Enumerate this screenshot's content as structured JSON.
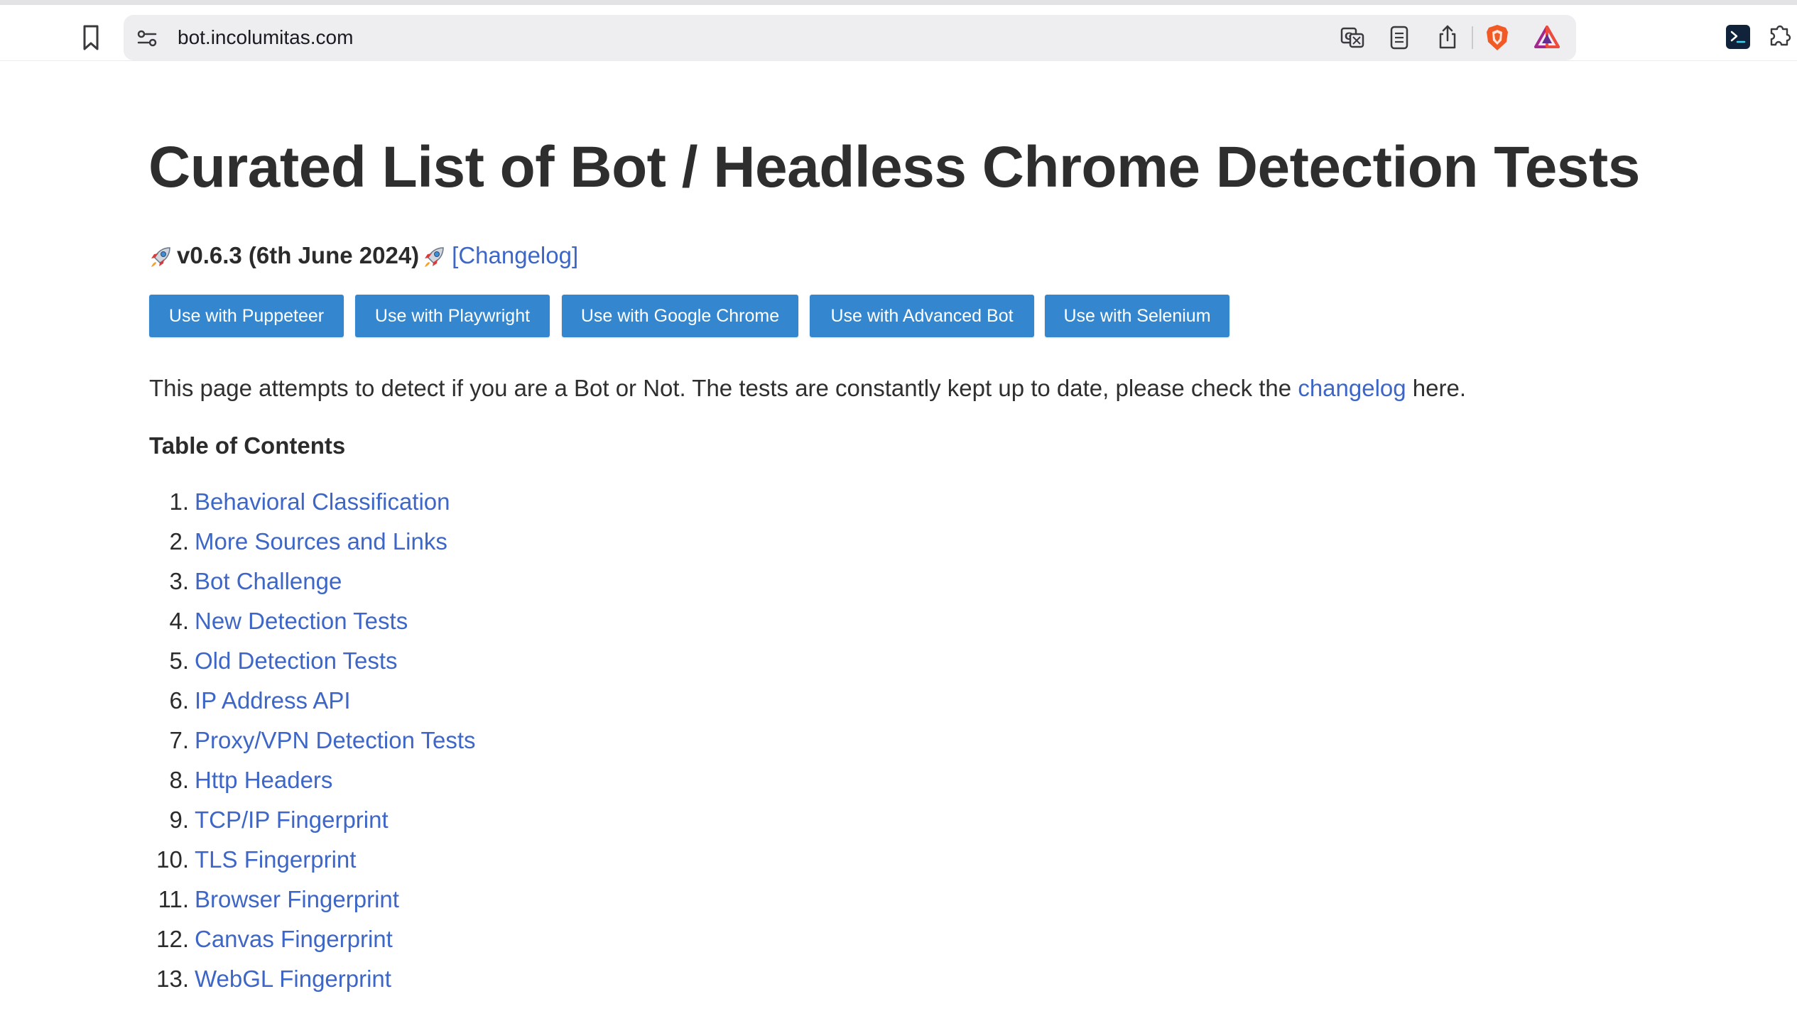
{
  "browser": {
    "url": "bot.incolumitas.com"
  },
  "page": {
    "title": "Curated List of Bot / Headless Chrome Detection Tests",
    "version_text": "v0.6.3 (6th June 2024)",
    "changelog_link": "[Changelog]",
    "buttons": [
      {
        "label": "Use with Puppeteer"
      },
      {
        "label": "Use with Playwright"
      },
      {
        "label": "Use with Google Chrome"
      },
      {
        "label": "Use with Advanced Bot"
      },
      {
        "label": "Use with Selenium"
      }
    ],
    "intro_before": "This page attempts to detect if you are a Bot or Not. The tests are constantly kept up to date, please check the ",
    "intro_link": "changelog",
    "intro_after": " here.",
    "toc_heading": "Table of Contents",
    "toc": [
      {
        "num": "1.",
        "label": "Behavioral Classification"
      },
      {
        "num": "2.",
        "label": "More Sources and Links"
      },
      {
        "num": "3.",
        "label": "Bot Challenge"
      },
      {
        "num": "4.",
        "label": "New Detection Tests"
      },
      {
        "num": "5.",
        "label": "Old Detection Tests"
      },
      {
        "num": "6.",
        "label": "IP Address API"
      },
      {
        "num": "7.",
        "label": "Proxy/VPN Detection Tests"
      },
      {
        "num": "8.",
        "label": "Http Headers"
      },
      {
        "num": "9.",
        "label": "TCP/IP Fingerprint"
      },
      {
        "num": "10.",
        "label": "TLS Fingerprint"
      },
      {
        "num": "11.",
        "label": "Browser Fingerprint"
      },
      {
        "num": "12.",
        "label": "Canvas Fingerprint"
      },
      {
        "num": "13.",
        "label": "WebGL Fingerprint"
      }
    ]
  },
  "colors": {
    "link": "#3d66c7",
    "button_bg": "#3487cf",
    "title": "#2e2e2e"
  },
  "icons": [
    "bookmark-icon",
    "site-settings-icon",
    "translate-icon",
    "reader-mode-icon",
    "share-icon",
    "brave-shields-icon",
    "brave-rewards-icon",
    "terminal-extension-icon",
    "extensions-puzzle-icon",
    "rocket-emoji"
  ]
}
